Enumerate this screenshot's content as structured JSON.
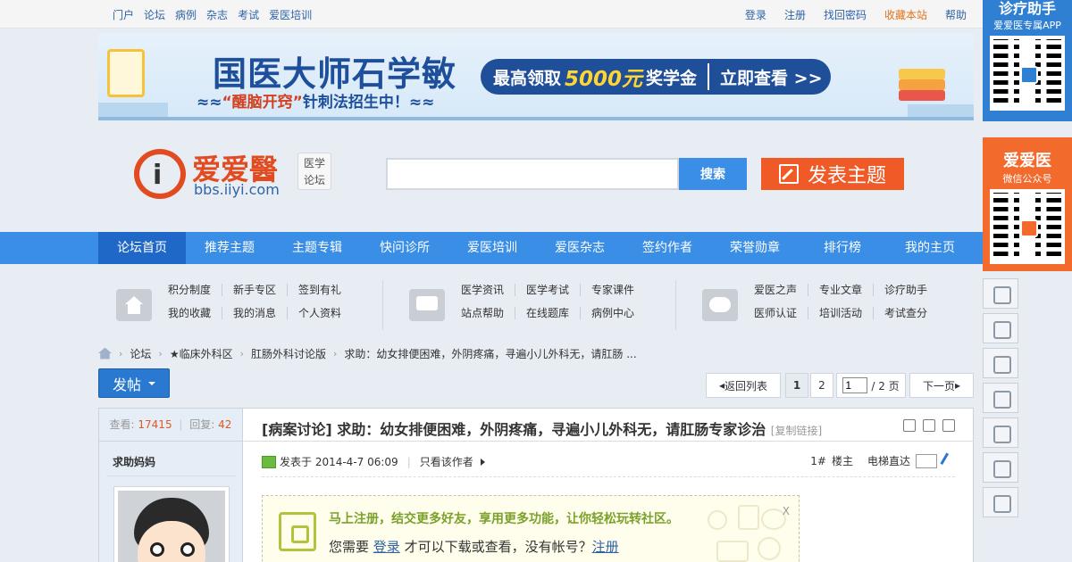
{
  "topbar": {
    "left_links": [
      "门户",
      "论坛",
      "病例",
      "杂志",
      "考试",
      "爱医培训"
    ],
    "login": "登录",
    "register": "注册",
    "recover": "找回密码",
    "favorite": "收藏本站",
    "help": "帮助"
  },
  "banner": {
    "title": "国医大师石学敏",
    "subtitle_pre": "≈≈",
    "subtitle_quote": "“醒脑开窍”",
    "subtitle_post": "针刺法招生中！≈≈",
    "cta_pre": "最高领取",
    "cta_money": "5000元",
    "cta_mid": "奖学金",
    "cta_action": "立即查看 >>"
  },
  "header": {
    "logo_mark": "i",
    "logo_cn": "爱爱醫",
    "logo_url": "bbs.iiyi.com",
    "logo_tag_1": "医学",
    "logo_tag_2": "论坛",
    "search_value": "",
    "search_button": "搜索",
    "post_topic": "发表主题"
  },
  "nav": [
    "论坛首页",
    "推荐主题",
    "主题专辑",
    "快问诊所",
    "爱医培训",
    "爱医杂志",
    "签约作者",
    "荣誉勋章",
    "排行榜",
    "我的主页"
  ],
  "quick": {
    "group1": [
      "积分制度",
      "新手专区",
      "签到有礼",
      "我的收藏",
      "我的消息",
      "个人资料"
    ],
    "group2": [
      "医学资讯",
      "医学考试",
      "专家课件",
      "站点帮助",
      "在线题库",
      "病例中心"
    ],
    "group3": [
      "爱医之声",
      "专业文章",
      "诊疗助手",
      "医师认证",
      "培训活动",
      "考试查分"
    ]
  },
  "breadcrumb": {
    "items": [
      "论坛",
      "★临床外科区",
      "肛肠外科讨论版",
      "求助：幼女排便困难，外阴疼痛，寻遍小儿外科无，请肛肠 ..."
    ],
    "arrow": "›"
  },
  "toolbar": {
    "post_button": "发帖",
    "back_list": "返回列表",
    "page_1": "1",
    "page_2": "2",
    "page_input": "1",
    "page_total": "/ 2 页",
    "next_page": "下一页"
  },
  "thread": {
    "views_label": "查看:",
    "views": "17415",
    "sep": "|",
    "replies_label": "回复:",
    "replies": "42",
    "author": "求助妈妈",
    "title": "[病案讨论] 求助：幼女排便困难，外阴疼痛，寻遍小儿外科无，请肛肠专家诊治",
    "copy_link": "[复制链接]",
    "posted_at": "发表于 2014-4-7 06:09",
    "only_author": "只看该作者",
    "floor": "1#",
    "floor_label": "楼主",
    "elevator": "电梯直达",
    "login_prompt_1": "马上注册，结交更多好友，享用更多功能，让你轻松玩转社区。",
    "login_prompt_2a": "您需要",
    "login_link": "登录",
    "login_prompt_2b": "才可以下载或查看，没有帐号？",
    "register_link": "注册",
    "close": "X"
  },
  "float": {
    "app_title": "诊疗助手",
    "app_sub": "爱爱医专属APP",
    "wx_title": "爱爱医",
    "wx_sub": "微信公众号"
  }
}
